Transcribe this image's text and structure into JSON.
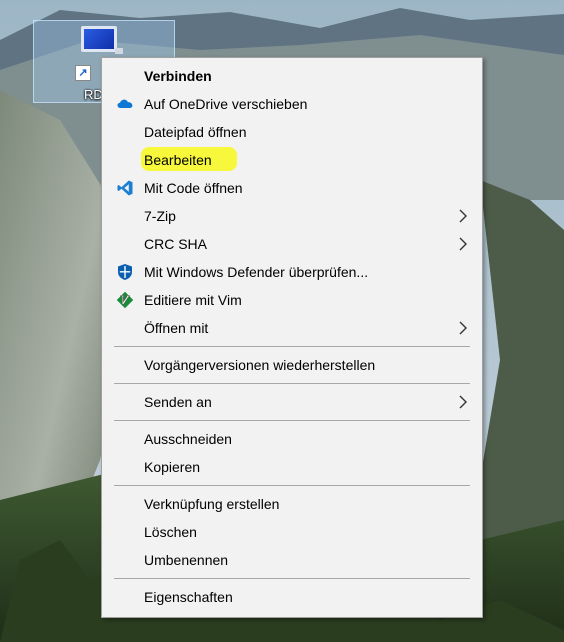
{
  "desktop": {
    "shortcut_label": "RD"
  },
  "context_menu": {
    "items": [
      {
        "label": "Verbinden",
        "bold": true
      },
      {
        "label": "Auf OneDrive verschieben",
        "icon": "onedrive-cloud-icon"
      },
      {
        "label": "Dateipfad öffnen"
      },
      {
        "label": "Bearbeiten",
        "highlighted": true,
        "highlight_color": "#f7f83b"
      },
      {
        "label": "Mit Code öffnen",
        "icon": "vscode-icon"
      },
      {
        "label": "7-Zip",
        "submenu": true
      },
      {
        "label": "CRC SHA",
        "submenu": true
      },
      {
        "label": "Mit Windows Defender überprüfen...",
        "icon": "windows-defender-shield-icon"
      },
      {
        "label": "Editiere mit Vim",
        "icon": "vim-icon"
      },
      {
        "label": "Öffnen mit",
        "submenu": true
      },
      {
        "label": "Vorgängerversionen wiederherstellen"
      },
      {
        "label": "Senden an",
        "submenu": true
      },
      {
        "label": "Ausschneiden"
      },
      {
        "label": "Kopieren"
      },
      {
        "label": "Verknüpfung erstellen"
      },
      {
        "label": "Löschen"
      },
      {
        "label": "Umbenennen"
      },
      {
        "label": "Eigenschaften"
      }
    ]
  },
  "colors": {
    "menu_background": "#f2f2f2",
    "highlight": "#f7f83b",
    "onedrive": "#0f78d4",
    "vscode": "#1e7fd1",
    "defender": "#0b5fb0",
    "vim": "#1a8b3a"
  }
}
